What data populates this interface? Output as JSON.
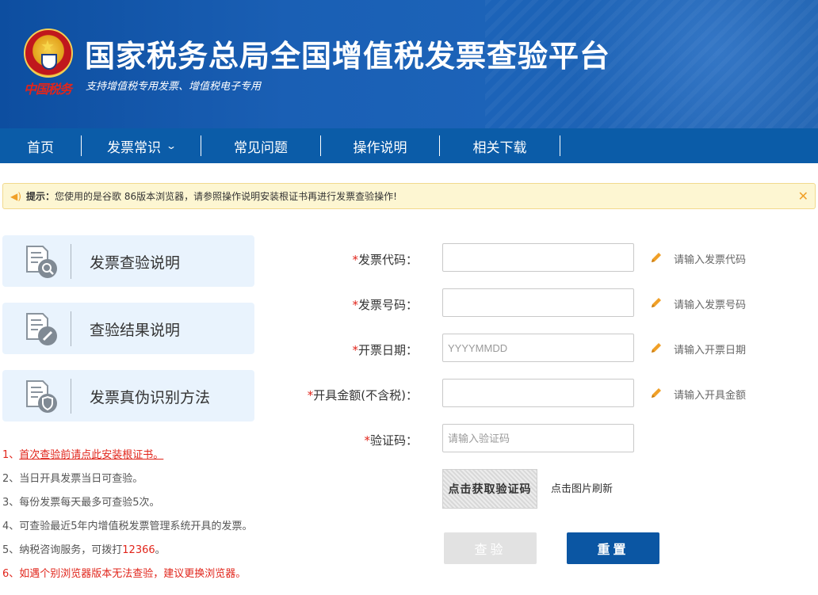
{
  "header": {
    "title": "国家税务总局全国增值税发票查验平台",
    "subtitle": "支持增值税专用发票、增值税电子专用",
    "seal_text": "中国税务",
    "emblem_icon": "national-emblem-icon"
  },
  "nav": {
    "items": [
      {
        "label": "首页"
      },
      {
        "label": "发票常识",
        "chevron": "chevron-down-icon"
      },
      {
        "label": "常见问题"
      },
      {
        "label": "操作说明"
      },
      {
        "label": "相关下载"
      }
    ]
  },
  "notice": {
    "label": "提示：",
    "text": "您使用的是谷歌 86版本浏览器，请参照操作说明安装根证书再进行发票查验操作!",
    "icon": "speaker-icon",
    "close_icon": "close-icon"
  },
  "cards": [
    {
      "label": "发票查验说明",
      "icon": "document-search-icon"
    },
    {
      "label": "查验结果说明",
      "icon": "document-edit-icon"
    },
    {
      "label": "发票真伪识别方法",
      "icon": "document-shield-icon"
    }
  ],
  "tips": {
    "t1_prefix": "1、",
    "t1_link": "首次查验前请点此安装根证书。",
    "t2": "2、当日开具发票当日可查验。",
    "t3": "3、每份发票每天最多可查验5次。",
    "t4": "4、可查验最近5年内增值税发票管理系统开具的发票。",
    "t5_prefix": "5、纳税咨询服务，可拨打",
    "t5_number": "12366",
    "t5_suffix": "。",
    "t6": "6、如遇个别浏览器版本无法查验，建议更换浏览器。"
  },
  "form": {
    "required_mark": "*",
    "code": {
      "label": "发票代码：",
      "value": "",
      "placeholder": "",
      "hint": "请输入发票代码"
    },
    "number": {
      "label": "发票号码：",
      "value": "",
      "placeholder": "",
      "hint": "请输入发票号码"
    },
    "date": {
      "label": "开票日期：",
      "value": "",
      "placeholder": "YYYYMMDD",
      "hint": "请输入开票日期"
    },
    "amount": {
      "label": "开具金额(不含税)：",
      "value": "",
      "placeholder": "",
      "hint": "请输入开具金额"
    },
    "captcha": {
      "label": "验证码：",
      "value": "",
      "placeholder": "请输入验证码"
    },
    "captcha_image_text": "点击获取验证码",
    "captcha_refresh_hint": "点击图片刷新",
    "check_button": "查验",
    "reset_button": "重置"
  },
  "colors": {
    "nav_bg": "#0b5ca8",
    "primary_button": "#0b56a3",
    "disabled_button": "#e2e2e2",
    "required": "#e1251b",
    "notice_bg": "#fdf6d2",
    "card_bg": "#e9f3fd"
  }
}
